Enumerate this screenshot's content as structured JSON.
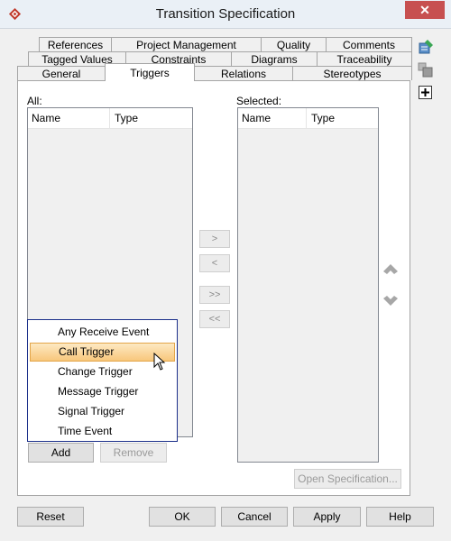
{
  "window": {
    "title": "Transition Specification",
    "close_glyph": "✕"
  },
  "tabs": {
    "row1": [
      "References",
      "Project Management",
      "Quality",
      "Comments"
    ],
    "row2": [
      "Tagged Values",
      "Constraints",
      "Diagrams",
      "Traceability"
    ],
    "row3": [
      "General",
      "Triggers",
      "Relations",
      "Stereotypes"
    ],
    "active": "Triggers"
  },
  "side_tools": [
    "edit-spec-icon",
    "shapes-icon",
    "add-icon"
  ],
  "all_list": {
    "label": "All:",
    "columns": [
      "Name",
      "Type"
    ]
  },
  "selected_list": {
    "label": "Selected:",
    "columns": [
      "Name",
      "Type"
    ]
  },
  "transfer_buttons": [
    ">",
    "<",
    ">>",
    "<<"
  ],
  "order_icons": [
    "move-up-icon",
    "move-down-icon"
  ],
  "add_label": "Add",
  "remove_label": "Remove",
  "open_spec_label": "Open Specification...",
  "popup_menu": {
    "items": [
      "Any Receive Event",
      "Call Trigger",
      "Change Trigger",
      "Message Trigger",
      "Signal Trigger",
      "Time Event"
    ],
    "highlighted": "Call Trigger"
  },
  "footer": {
    "reset": "Reset",
    "ok": "OK",
    "cancel": "Cancel",
    "apply": "Apply",
    "help": "Help"
  },
  "colors": {
    "accent": "#1b2f8a",
    "highlight": "#f8c77c",
    "close": "#c75050"
  }
}
